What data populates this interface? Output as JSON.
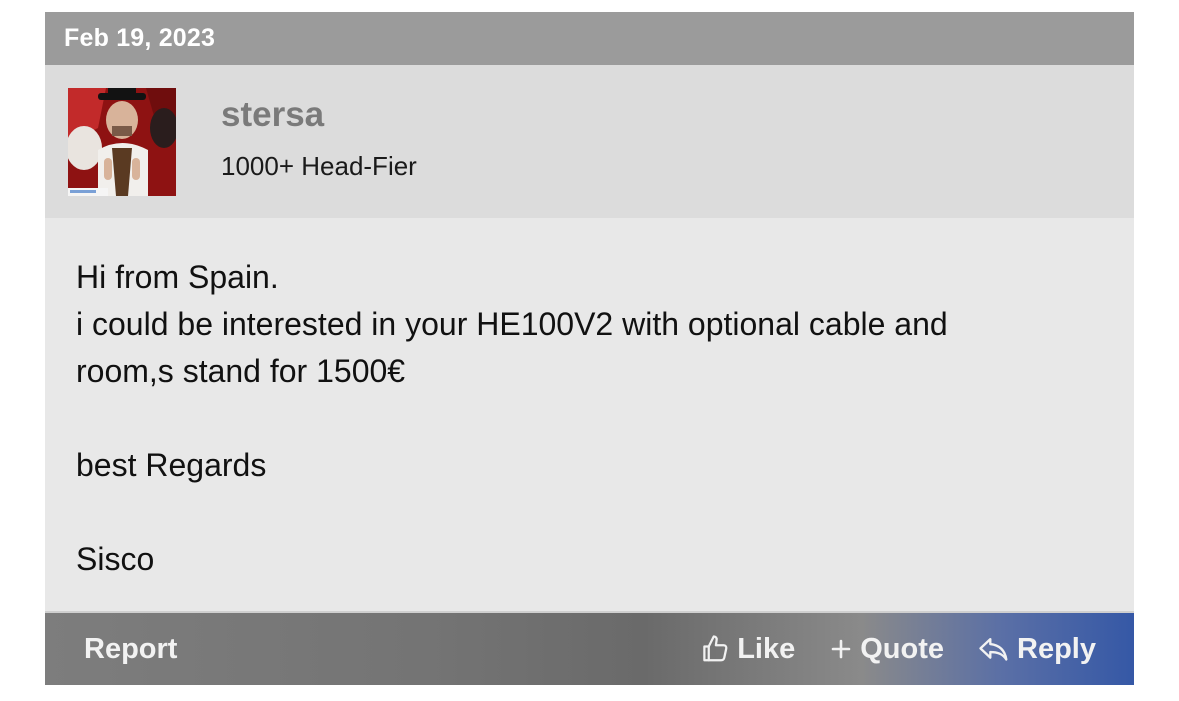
{
  "post": {
    "date": "Feb 19, 2023",
    "author": {
      "username": "stersa",
      "title": "1000+ Head-Fier"
    },
    "body_lines": [
      "Hi from Spain.",
      "i could be interested in your HE100V2 with optional cable and",
      "room,s stand for 1500€",
      "",
      "best Regards",
      "",
      "Sisco"
    ],
    "actions": {
      "report_label": "Report",
      "like_label": "Like",
      "quote_label": "Quote",
      "reply_label": "Reply"
    }
  },
  "colors": {
    "date_bar": "#9b9b9b",
    "author_bar": "#dcdcdc",
    "body_bg": "#e8e8e8",
    "action_bar_start": "#7d7d7d",
    "action_bar_end": "#3558a6"
  },
  "icons": {
    "like": "thumbs-up-icon",
    "quote": "plus-icon",
    "reply": "reply-arrow-icon"
  }
}
